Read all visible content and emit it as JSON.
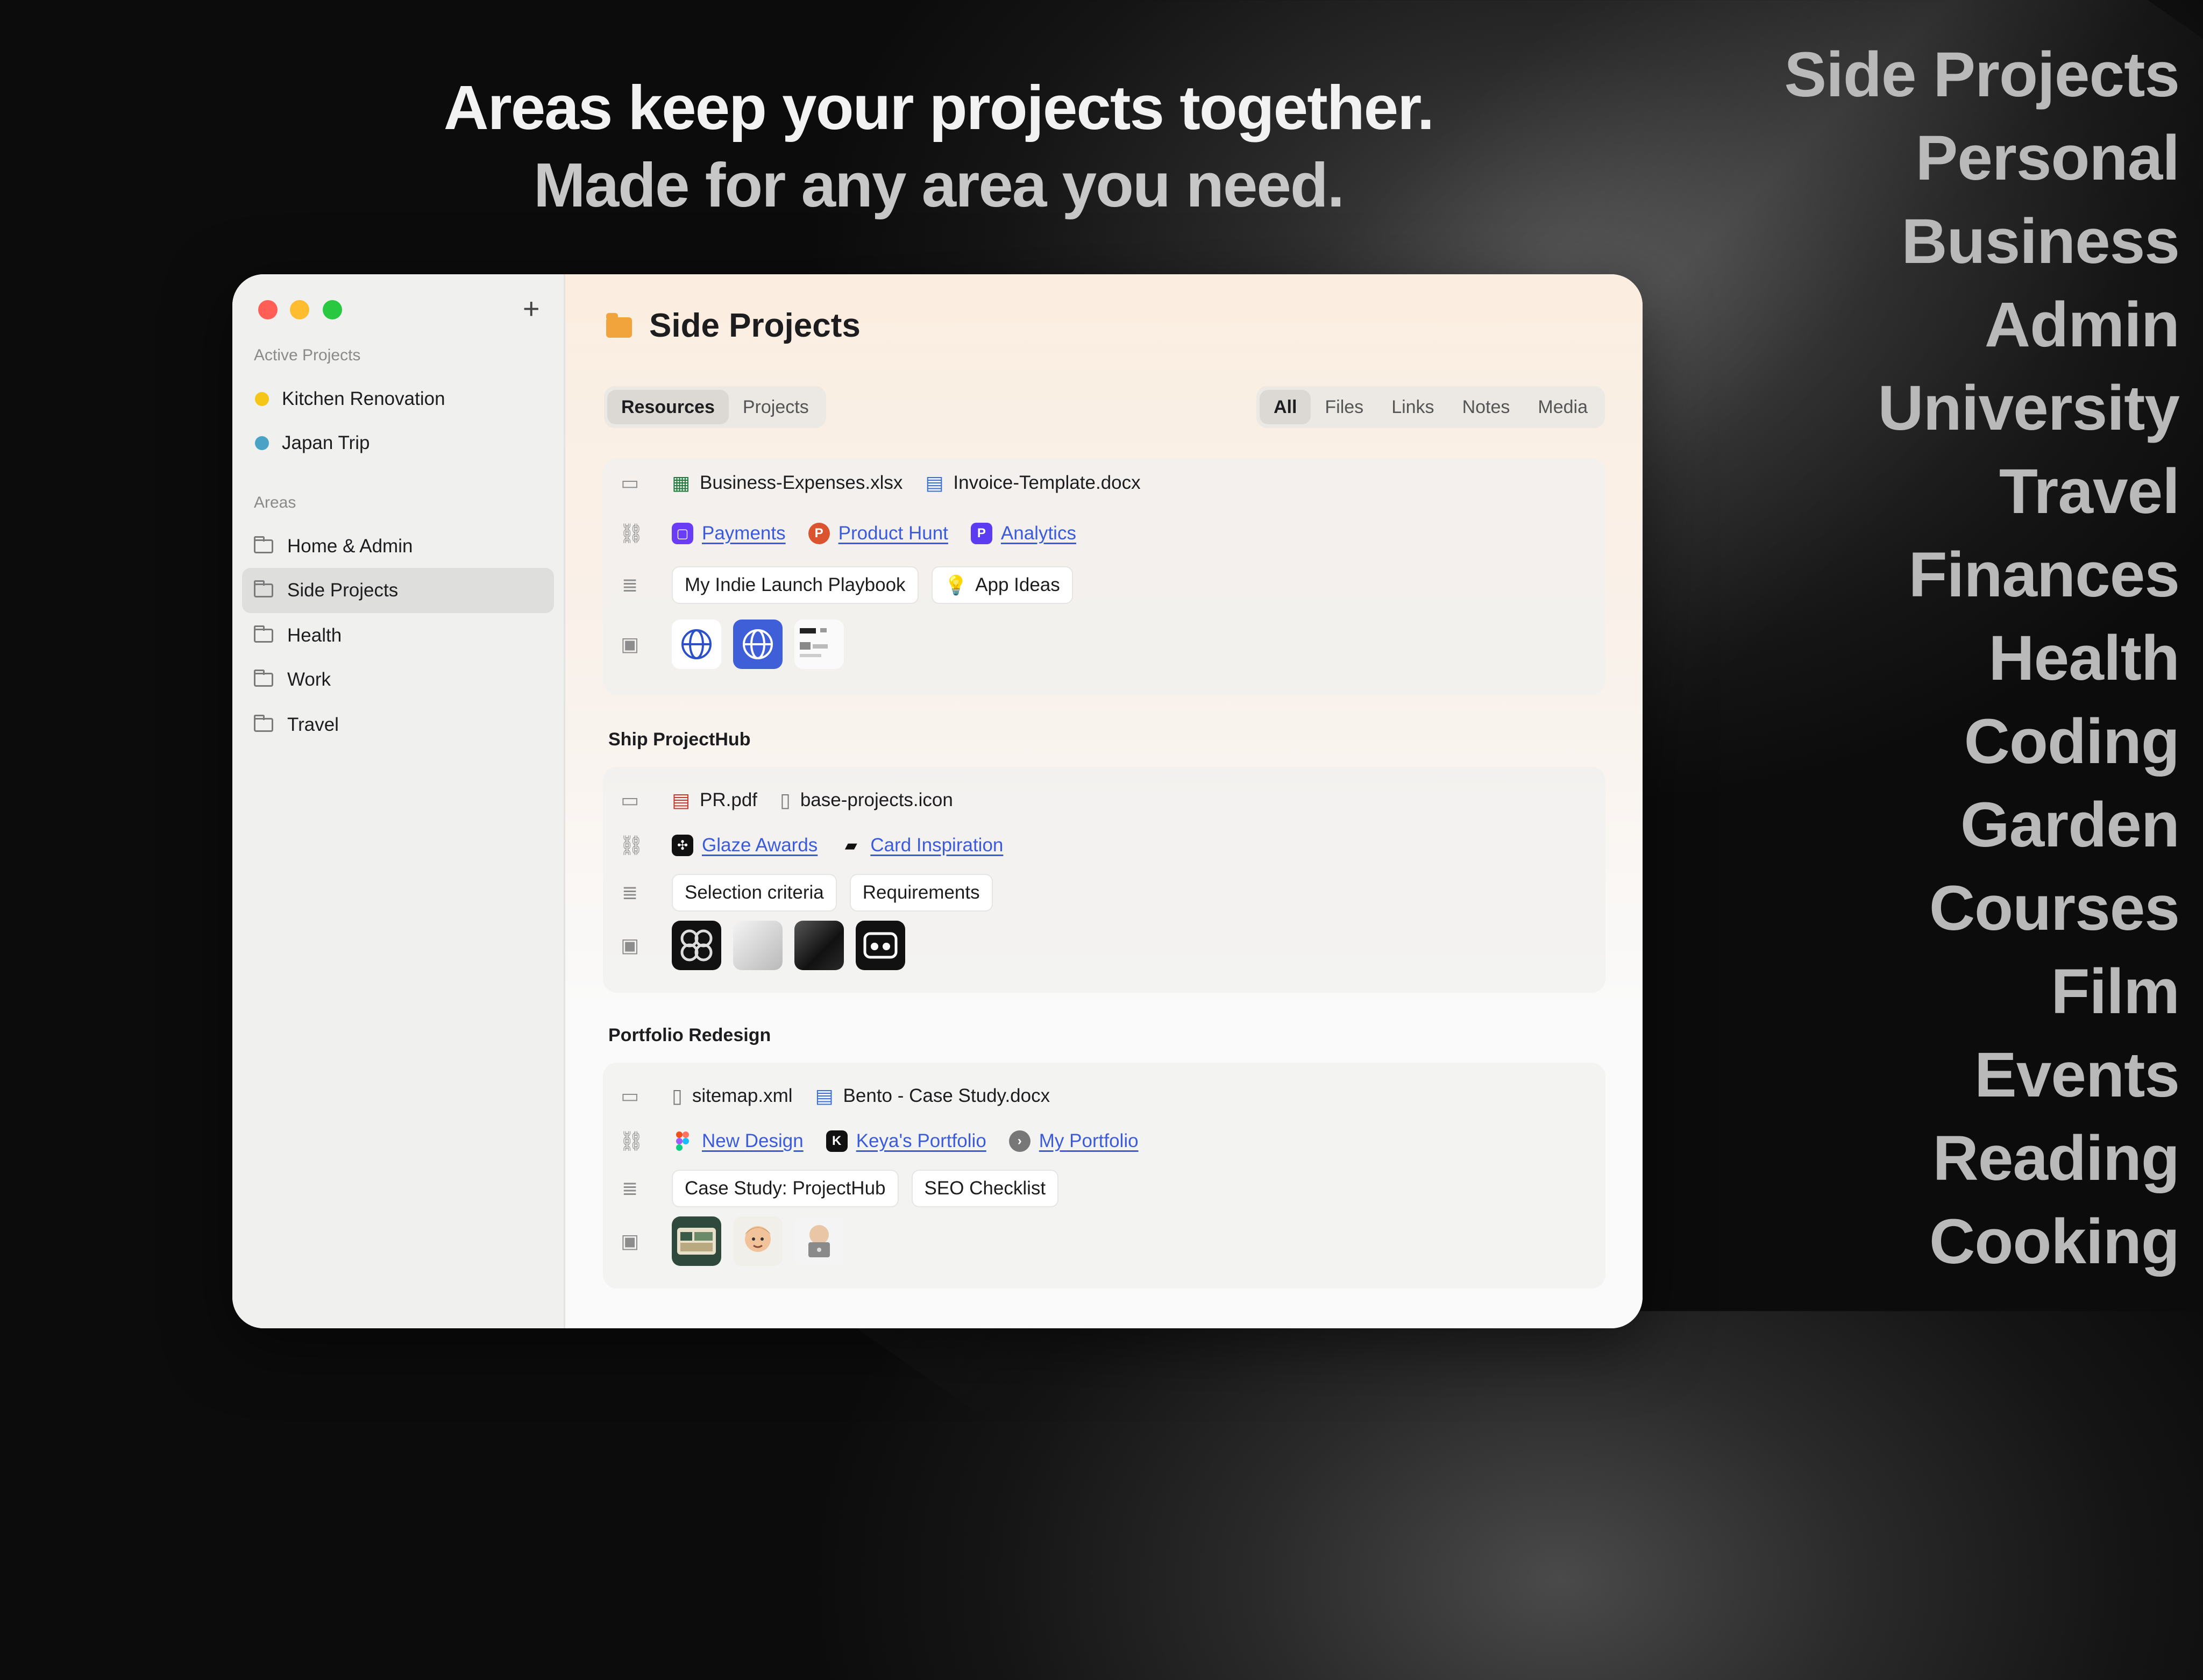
{
  "headline": {
    "line1": "Areas keep your projects together.",
    "line2": "Made for any area you need."
  },
  "area_names": [
    "Side Projects",
    "Personal",
    "Business",
    "Admin",
    "University",
    "Travel",
    "Finances",
    "Health",
    "Coding",
    "Garden",
    "Courses",
    "Film",
    "Events",
    "Reading",
    "Cooking"
  ],
  "sidebar": {
    "active_label": "Active Projects",
    "active": [
      {
        "label": "Kitchen Renovation",
        "color": "#f5c518"
      },
      {
        "label": "Japan Trip",
        "color": "#4aa3c7"
      }
    ],
    "areas_label": "Areas",
    "areas": [
      "Home & Admin",
      "Side Projects",
      "Health",
      "Work",
      "Travel"
    ],
    "selected": "Side Projects",
    "add_icon": "plus-icon"
  },
  "main": {
    "title": "Side Projects",
    "tabs": [
      "Resources",
      "Projects"
    ],
    "active_tab": "Resources",
    "filters": [
      "All",
      "Files",
      "Links",
      "Notes",
      "Media"
    ],
    "active_filter": "All",
    "groups": [
      {
        "label": "",
        "files": [
          {
            "name": "Business-Expenses.xlsx",
            "icon": "spreadsheet-icon"
          },
          {
            "name": "Invoice-Template.docx",
            "icon": "doc-icon"
          }
        ],
        "links": [
          {
            "name": "Payments",
            "icon": "payments-icon"
          },
          {
            "name": "Product Hunt",
            "icon": "producthunt-icon"
          },
          {
            "name": "Analytics",
            "icon": "analytics-icon"
          }
        ],
        "notes": [
          {
            "name": "My Indie Launch Playbook"
          },
          {
            "name": "App Ideas",
            "icon": "lightbulb-icon"
          }
        ]
      },
      {
        "label": "Ship ProjectHub",
        "files": [
          {
            "name": "PR.pdf",
            "icon": "pdf-icon"
          },
          {
            "name": "base-projects.icon",
            "icon": "file-icon"
          }
        ],
        "links": [
          {
            "name": "Glaze Awards",
            "icon": "glaze-icon"
          },
          {
            "name": "Card Inspiration",
            "icon": "cards-icon"
          }
        ],
        "notes": [
          {
            "name": "Selection criteria"
          },
          {
            "name": "Requirements"
          }
        ]
      },
      {
        "label": "Portfolio Redesign",
        "files": [
          {
            "name": "sitemap.xml",
            "icon": "file-icon"
          },
          {
            "name": "Bento - Case Study.docx",
            "icon": "doc-icon"
          }
        ],
        "links": [
          {
            "name": "New Design",
            "icon": "figma-icon"
          },
          {
            "name": "Keya's Portfolio",
            "icon": "framer-icon"
          },
          {
            "name": "My Portfolio",
            "icon": "arrow-circle-icon"
          }
        ],
        "notes": [
          {
            "name": "Case Study: ProjectHub"
          },
          {
            "name": "SEO Checklist"
          }
        ]
      }
    ],
    "colors": {
      "accent": "#3b5bdb",
      "folder": "#f1a33c"
    }
  }
}
